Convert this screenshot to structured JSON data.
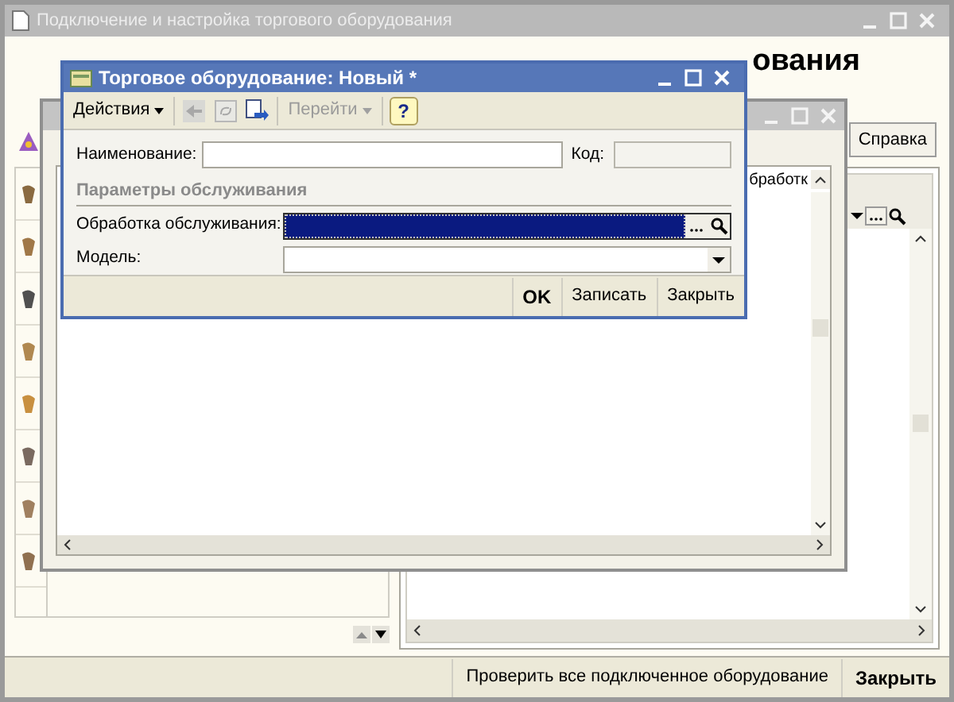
{
  "main_window": {
    "title": "Подключение и настройка торгового оборудования",
    "active": false,
    "heading": "ования",
    "help_button": "Справка",
    "buttons": [
      {
        "label": "Проверить все подключенное оборудование",
        "default": false
      },
      {
        "label": "Закрыть",
        "default": true
      }
    ]
  },
  "list_window": {
    "active": false,
    "column_fragment": "бработк"
  },
  "dialog": {
    "title": "Торговое оборудование: Новый *",
    "active": true,
    "toolbar": [
      {
        "kind": "menu",
        "label": "Действия",
        "disabled": false
      },
      {
        "kind": "back",
        "disabled": true
      },
      {
        "kind": "refresh",
        "disabled": true
      },
      {
        "kind": "goto",
        "disabled": false
      },
      {
        "kind": "menu",
        "label": "Перейти",
        "disabled": true
      },
      {
        "kind": "help",
        "label": "?",
        "disabled": false
      }
    ],
    "name_label": "Наименование:",
    "code_label": "Код:",
    "section": "Параметры обслуживания",
    "processing": {
      "label": "Обработка обслуживания:",
      "selected": true
    },
    "model": {
      "label": "Модель:",
      "selected": false
    },
    "buttons": [
      {
        "label": "OK",
        "default": true
      },
      {
        "label": "Записать",
        "default": false
      },
      {
        "label": "Закрыть",
        "default": false
      }
    ]
  }
}
